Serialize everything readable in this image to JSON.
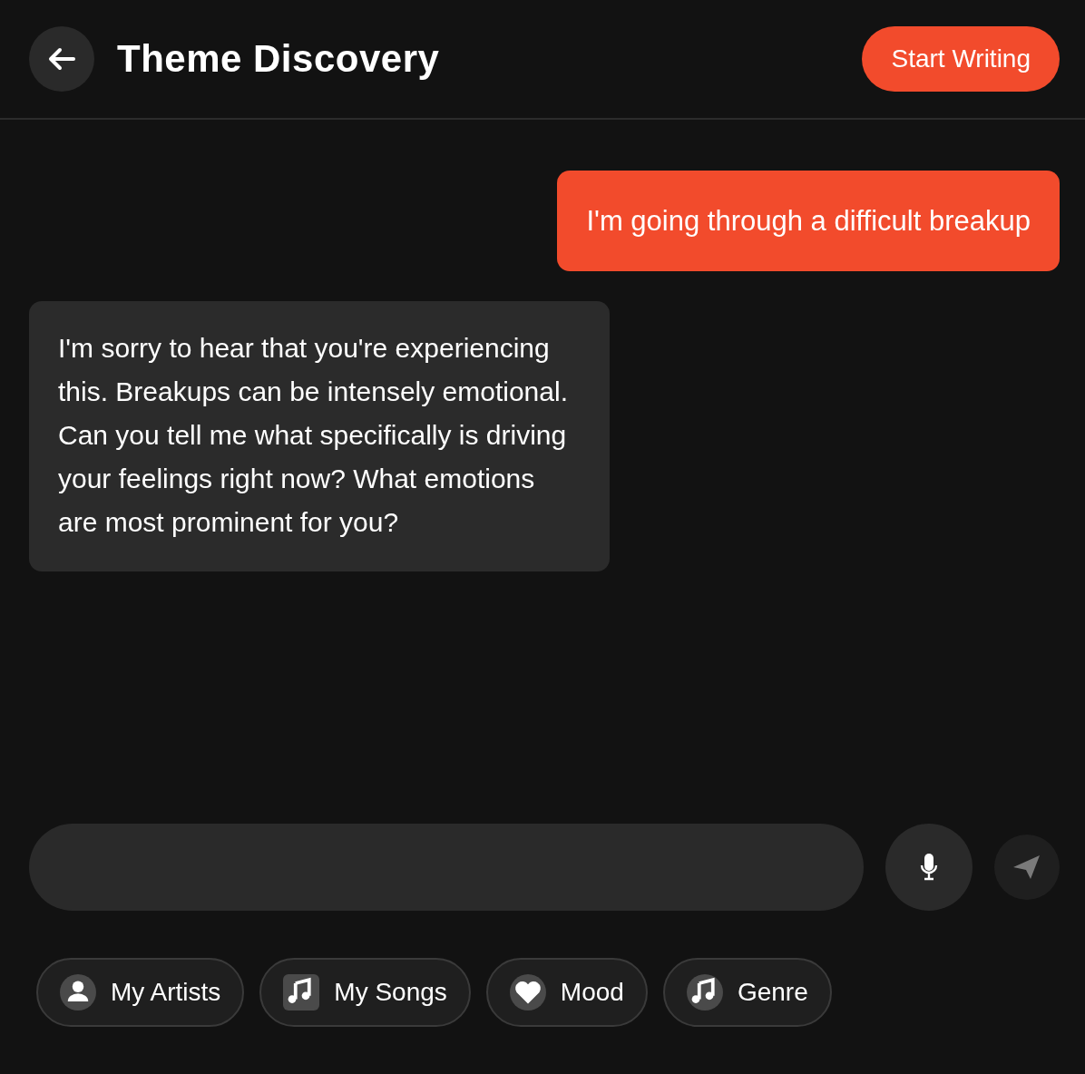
{
  "header": {
    "title": "Theme Discovery",
    "action": "Start Writing"
  },
  "messages": [
    {
      "kind": "user",
      "text": "I'm going through a difficult breakup"
    },
    {
      "kind": "assistant",
      "text": "I'm sorry to hear that you're experiencing this. Breakups can be intensely emotional. Can you tell me what specifically is driving your feelings right now? What emotions are most prominent for you?"
    }
  ],
  "composer": {
    "send_disabled": true
  },
  "chips": [
    {
      "kind": "artists",
      "label": "My Artists"
    },
    {
      "kind": "songs",
      "label": "My Songs"
    },
    {
      "kind": "mood",
      "label": "Mood"
    },
    {
      "kind": "genre",
      "label": "Genre"
    }
  ]
}
